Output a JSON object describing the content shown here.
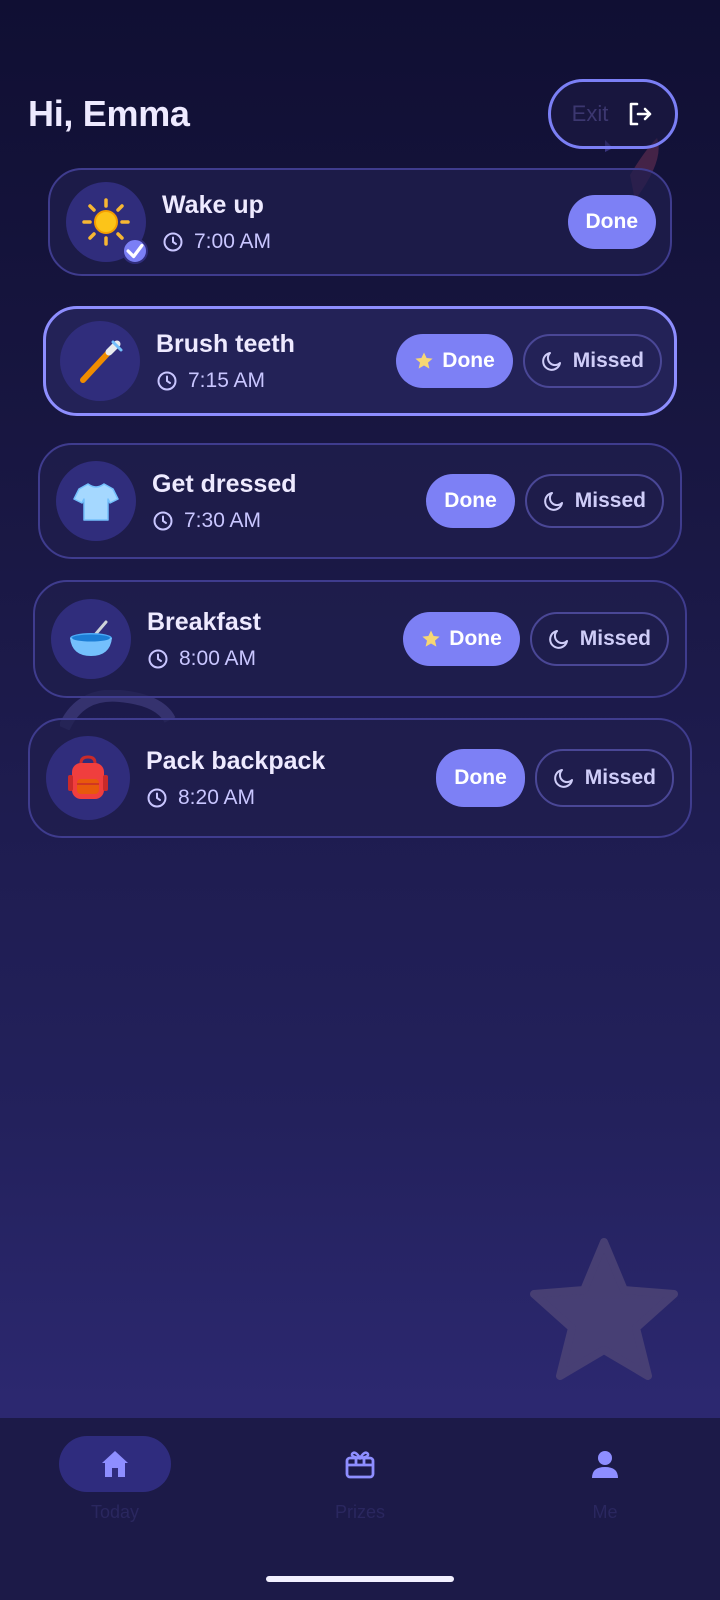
{
  "header": {
    "greeting": "Hi, Emma",
    "exit_label": "Exit",
    "exit_icon": "exit-icon"
  },
  "tasks": [
    {
      "title": "Wake up",
      "time": "7:00 AM",
      "icon": "sun-icon",
      "completed": true,
      "done_label": "Done",
      "done_star": false
    },
    {
      "title": "Brush teeth",
      "time": "7:15 AM",
      "icon": "toothbrush-icon",
      "completed": false,
      "done_label": "Done",
      "missed_label": "Missed",
      "done_star": true
    },
    {
      "title": "Get dressed",
      "time": "7:30 AM",
      "icon": "tshirt-icon",
      "completed": false,
      "done_label": "Done",
      "missed_label": "Missed",
      "done_star": false
    },
    {
      "title": "Breakfast",
      "time": "8:00 AM",
      "icon": "bowl-icon",
      "completed": false,
      "done_label": "Done",
      "missed_label": "Missed",
      "done_star": true
    },
    {
      "title": "Pack backpack",
      "time": "8:20 AM",
      "icon": "backpack-icon",
      "completed": false,
      "done_label": "Done",
      "missed_label": "Missed",
      "done_star": false
    }
  ],
  "nav": {
    "items": [
      {
        "label": "Today",
        "icon": "home-icon",
        "active": true
      },
      {
        "label": "Prizes",
        "icon": "gift-icon",
        "active": false
      },
      {
        "label": "Me",
        "icon": "person-icon",
        "active": false
      }
    ]
  },
  "colors": {
    "accent": "#7d80f5",
    "card_border": "#3f3c8e",
    "active_border": "#8e8eff",
    "background_top": "#100f33",
    "background_bottom": "#2e2a74",
    "star": "#f7d774"
  }
}
